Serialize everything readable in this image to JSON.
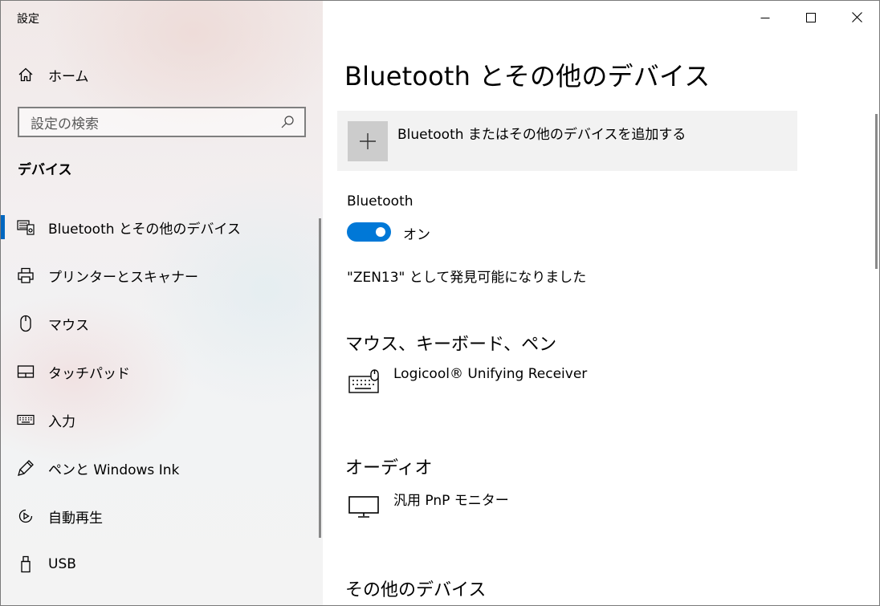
{
  "window": {
    "title": "設定"
  },
  "sidebar": {
    "home_label": "ホーム",
    "search_placeholder": "設定の検索",
    "section_title": "デバイス",
    "items": [
      {
        "label": "Bluetooth とその他のデバイス",
        "icon": "bluetooth-devices-icon",
        "active": true
      },
      {
        "label": "プリンターとスキャナー",
        "icon": "printer-icon"
      },
      {
        "label": "マウス",
        "icon": "mouse-icon"
      },
      {
        "label": "タッチパッド",
        "icon": "touchpad-icon"
      },
      {
        "label": "入力",
        "icon": "keyboard-icon"
      },
      {
        "label": "ペンと Windows Ink",
        "icon": "pen-icon"
      },
      {
        "label": "自動再生",
        "icon": "autoplay-icon"
      },
      {
        "label": "USB",
        "icon": "usb-icon"
      }
    ]
  },
  "main": {
    "title": "Bluetooth とその他のデバイス",
    "add_device_label": "Bluetooth またはその他のデバイスを追加する",
    "bluetooth_label": "Bluetooth",
    "bluetooth_state": "オン",
    "discoverable_text": "\"ZEN13\" として発見可能になりました",
    "groups": [
      {
        "title": "マウス、キーボード、ペン",
        "devices": [
          {
            "name": "Logicool® Unifying Receiver",
            "icon": "keyboard-mouse-icon"
          }
        ]
      },
      {
        "title": "オーディオ",
        "devices": [
          {
            "name": "汎用 PnP モニター",
            "icon": "monitor-icon"
          }
        ]
      },
      {
        "title": "その他のデバイス",
        "devices": []
      }
    ]
  },
  "colors": {
    "accent": "#0078d7",
    "active_indicator": "#0067c0",
    "add_tile": "#f2f2f2"
  }
}
